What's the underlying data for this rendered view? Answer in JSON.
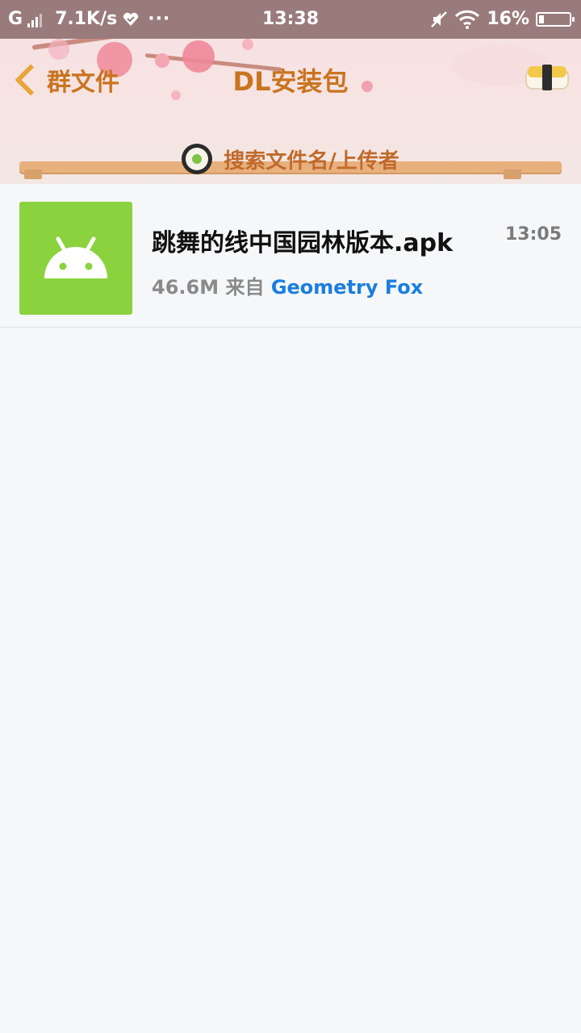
{
  "status_bar": {
    "carrier": "G",
    "net_speed": "7.1K/s",
    "extra": "···",
    "time": "13:38",
    "battery": "16%",
    "battery_level": 0.16
  },
  "header": {
    "back_label": "群文件",
    "title": "DL安装包",
    "search_placeholder": "搜索文件名/上传者"
  },
  "files": [
    {
      "name": "跳舞的线中国园林版本.apk",
      "time": "13:05",
      "size": "46.6M",
      "from_label": "来自",
      "uploader": "Geometry Fox",
      "icon": "android-icon"
    }
  ],
  "colors": {
    "status_bar": "#9a7b7c",
    "accent_orange": "#c9741f",
    "apk_green": "#8bd33e",
    "link_blue": "#1a7ee0"
  }
}
